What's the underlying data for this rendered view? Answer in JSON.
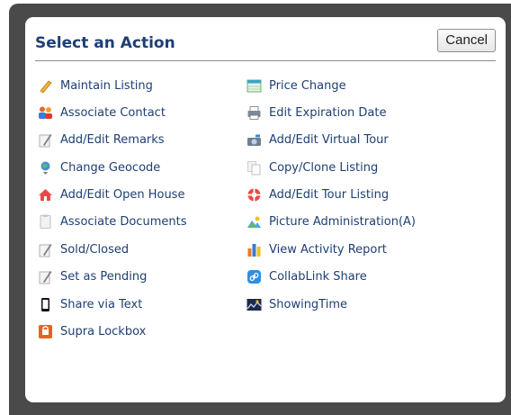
{
  "dialog": {
    "title": "Select an Action",
    "cancel_label": "Cancel"
  },
  "actions_left": [
    {
      "label": "Maintain Listing",
      "icon": "pencil-icon"
    },
    {
      "label": "Associate Contact",
      "icon": "contacts-icon"
    },
    {
      "label": "Add/Edit Remarks",
      "icon": "edit-note-icon"
    },
    {
      "label": "Change Geocode",
      "icon": "globe-pin-icon"
    },
    {
      "label": "Add/Edit Open House",
      "icon": "house-icon"
    },
    {
      "label": "Associate Documents",
      "icon": "document-icon"
    },
    {
      "label": "Sold/Closed",
      "icon": "edit-note-icon"
    },
    {
      "label": "Set as Pending",
      "icon": "edit-note-icon"
    },
    {
      "label": "Share via Text",
      "icon": "phone-icon"
    },
    {
      "label": "Supra Lockbox",
      "icon": "lockbox-icon"
    }
  ],
  "actions_right": [
    {
      "label": "Price Change",
      "icon": "price-table-icon"
    },
    {
      "label": "Edit Expiration Date",
      "icon": "printer-icon"
    },
    {
      "label": "Add/Edit Virtual Tour",
      "icon": "camera-icon"
    },
    {
      "label": "Copy/Clone Listing",
      "icon": "copy-icon"
    },
    {
      "label": "Add/Edit Tour Listing",
      "icon": "lifebuoy-icon"
    },
    {
      "label": "Picture Administration(A)",
      "icon": "picture-icon"
    },
    {
      "label": " View Activity Report",
      "icon": "bar-chart-icon"
    },
    {
      "label": "CollabLink Share",
      "icon": "link-icon"
    },
    {
      "label": "ShowingTime",
      "icon": "showingtime-icon"
    }
  ]
}
